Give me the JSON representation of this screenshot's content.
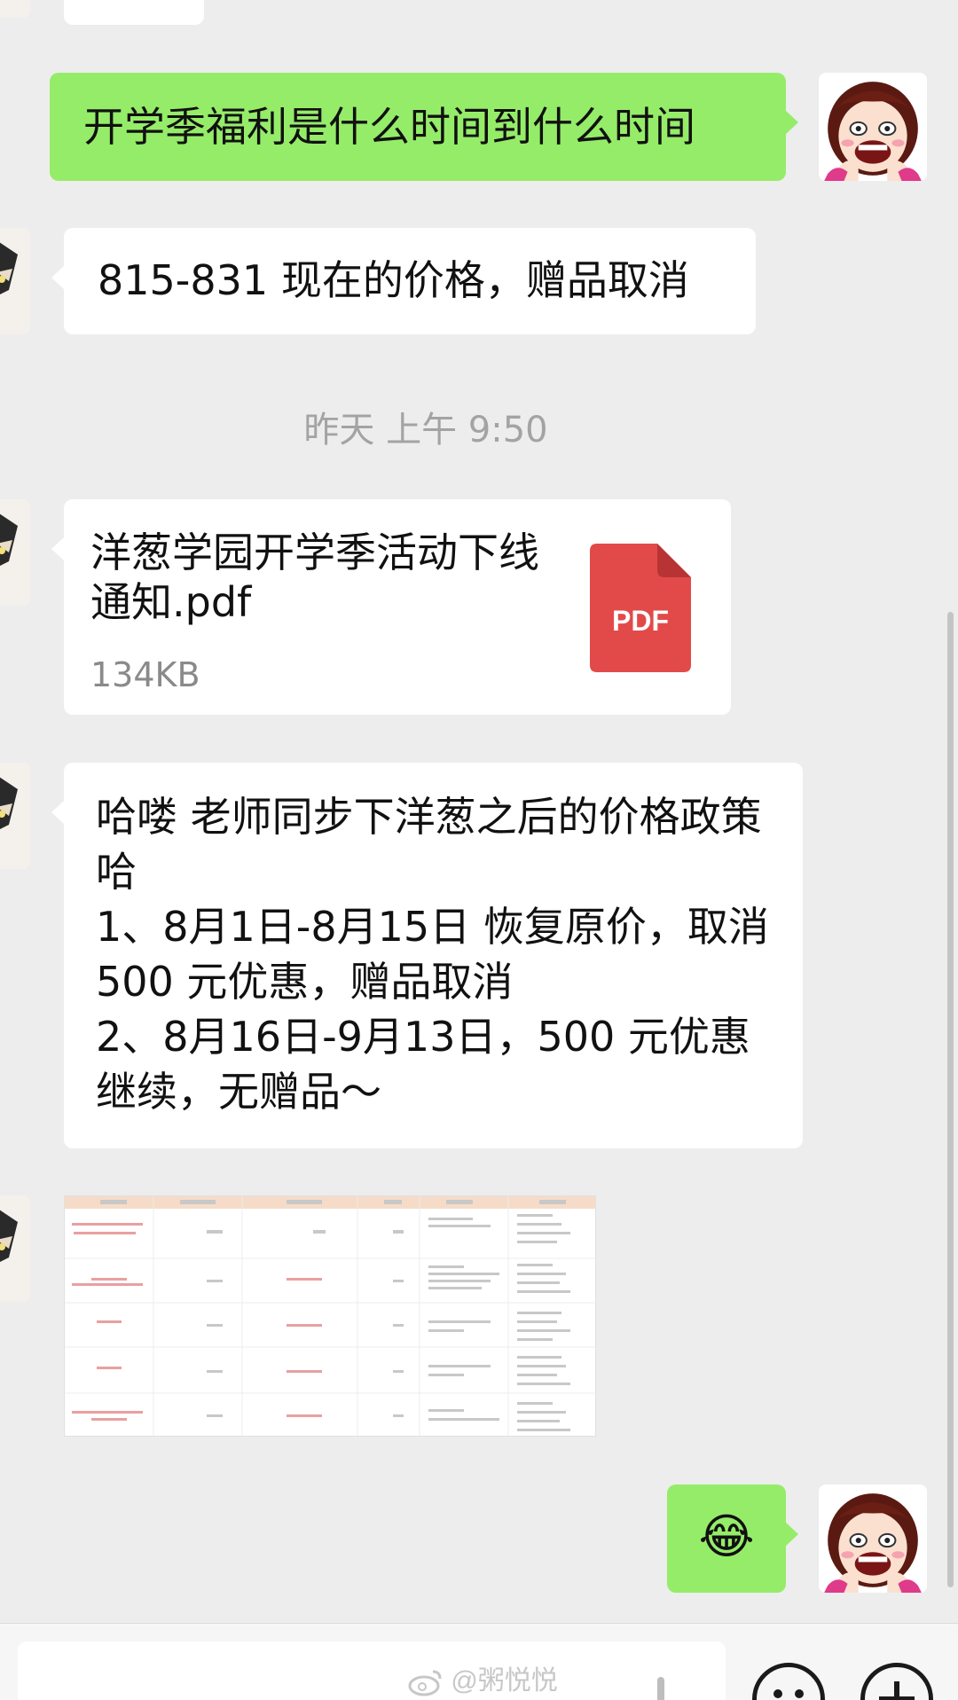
{
  "messages": {
    "m1_outgoing": "开学季福利是什么时间到什么时间",
    "m2_incoming": "815-831 现在的价格，赠品取消",
    "timestamp": "昨天 上午 9:50",
    "m3_file": {
      "name": "洋葱学园开学季活动下线通知.pdf",
      "size": "134KB",
      "icon_label": "PDF",
      "icon_color": "#e24a4a"
    },
    "m4_incoming": "哈喽 老师同步下洋葱之后的价格政策哈\n1、8月1日-8月15日 恢复原价，取消 500 元优惠，赠品取消\n2、8月16日-9月13日，500 元优惠继续，无赠品～",
    "m5_image_desc": "table screenshot",
    "m6_outgoing_emoji": "😂"
  },
  "watermark": "@粥悦悦",
  "colors": {
    "outgoing_bubble": "#95ec69",
    "incoming_bubble": "#ffffff",
    "background": "#ededed"
  }
}
